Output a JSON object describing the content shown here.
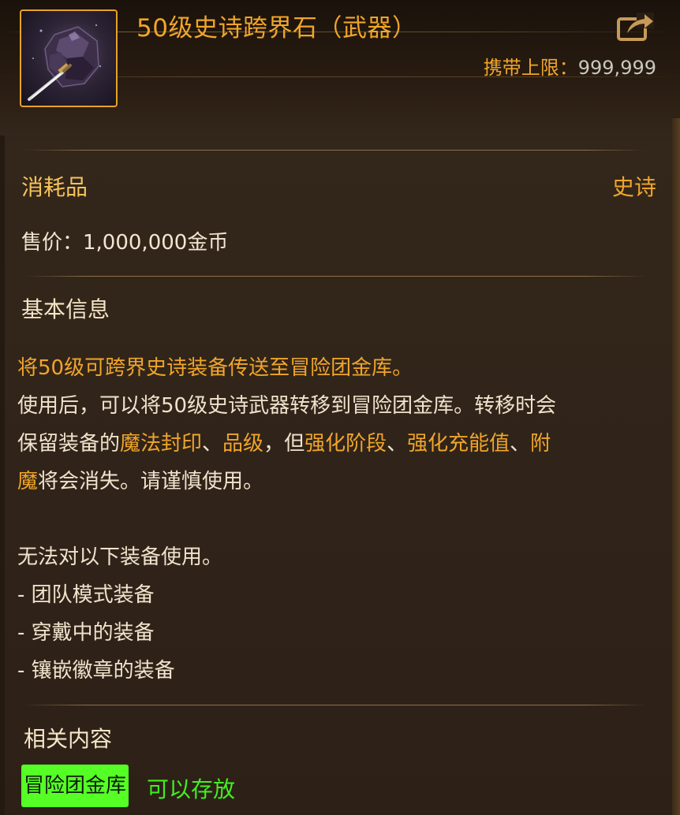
{
  "item": {
    "title": "50级史诗跨界石（武器）",
    "icon": "cross-border-stone-icon",
    "carry_limit_label": "携带上限：",
    "carry_limit_value": "999,999",
    "share_icon": "share-icon"
  },
  "properties": {
    "category": "消耗品",
    "rarity": "史诗",
    "price": "售价：1,000,000金币"
  },
  "basic_info": {
    "title": "基本信息",
    "summary": "将50级可跨界史诗装备传送至冒险团金库。",
    "lines": [
      [
        {
          "t": "使用后，可以将50级史诗武器转移到冒险团金库。转移时会",
          "hl": false
        }
      ],
      [
        {
          "t": "保留装备的",
          "hl": false
        },
        {
          "t": "魔法封印",
          "hl": true
        },
        {
          "t": "、",
          "hl": false
        },
        {
          "t": "品级",
          "hl": true
        },
        {
          "t": "，但",
          "hl": false
        },
        {
          "t": "强化阶段",
          "hl": true
        },
        {
          "t": "、",
          "hl": false
        },
        {
          "t": "强化充能值",
          "hl": true
        },
        {
          "t": "、",
          "hl": false
        },
        {
          "t": "附",
          "hl": true
        }
      ],
      [
        {
          "t": "魔",
          "hl": true
        },
        {
          "t": "将会消失。请谨慎使用。",
          "hl": false
        }
      ]
    ],
    "restriction_title": "无法对以下装备使用。",
    "restrictions": [
      "- 团队模式装备",
      "- 穿戴中的装备",
      "- 镶嵌徽章的装备"
    ]
  },
  "related": {
    "title": "相关内容",
    "storage_tag": "冒险团金库",
    "storage_status": "可以存放"
  },
  "colors": {
    "accent_orange": "#f0a52a",
    "storage_green": "#55ff26",
    "status_green": "#44ee22",
    "background": "#30241a"
  }
}
